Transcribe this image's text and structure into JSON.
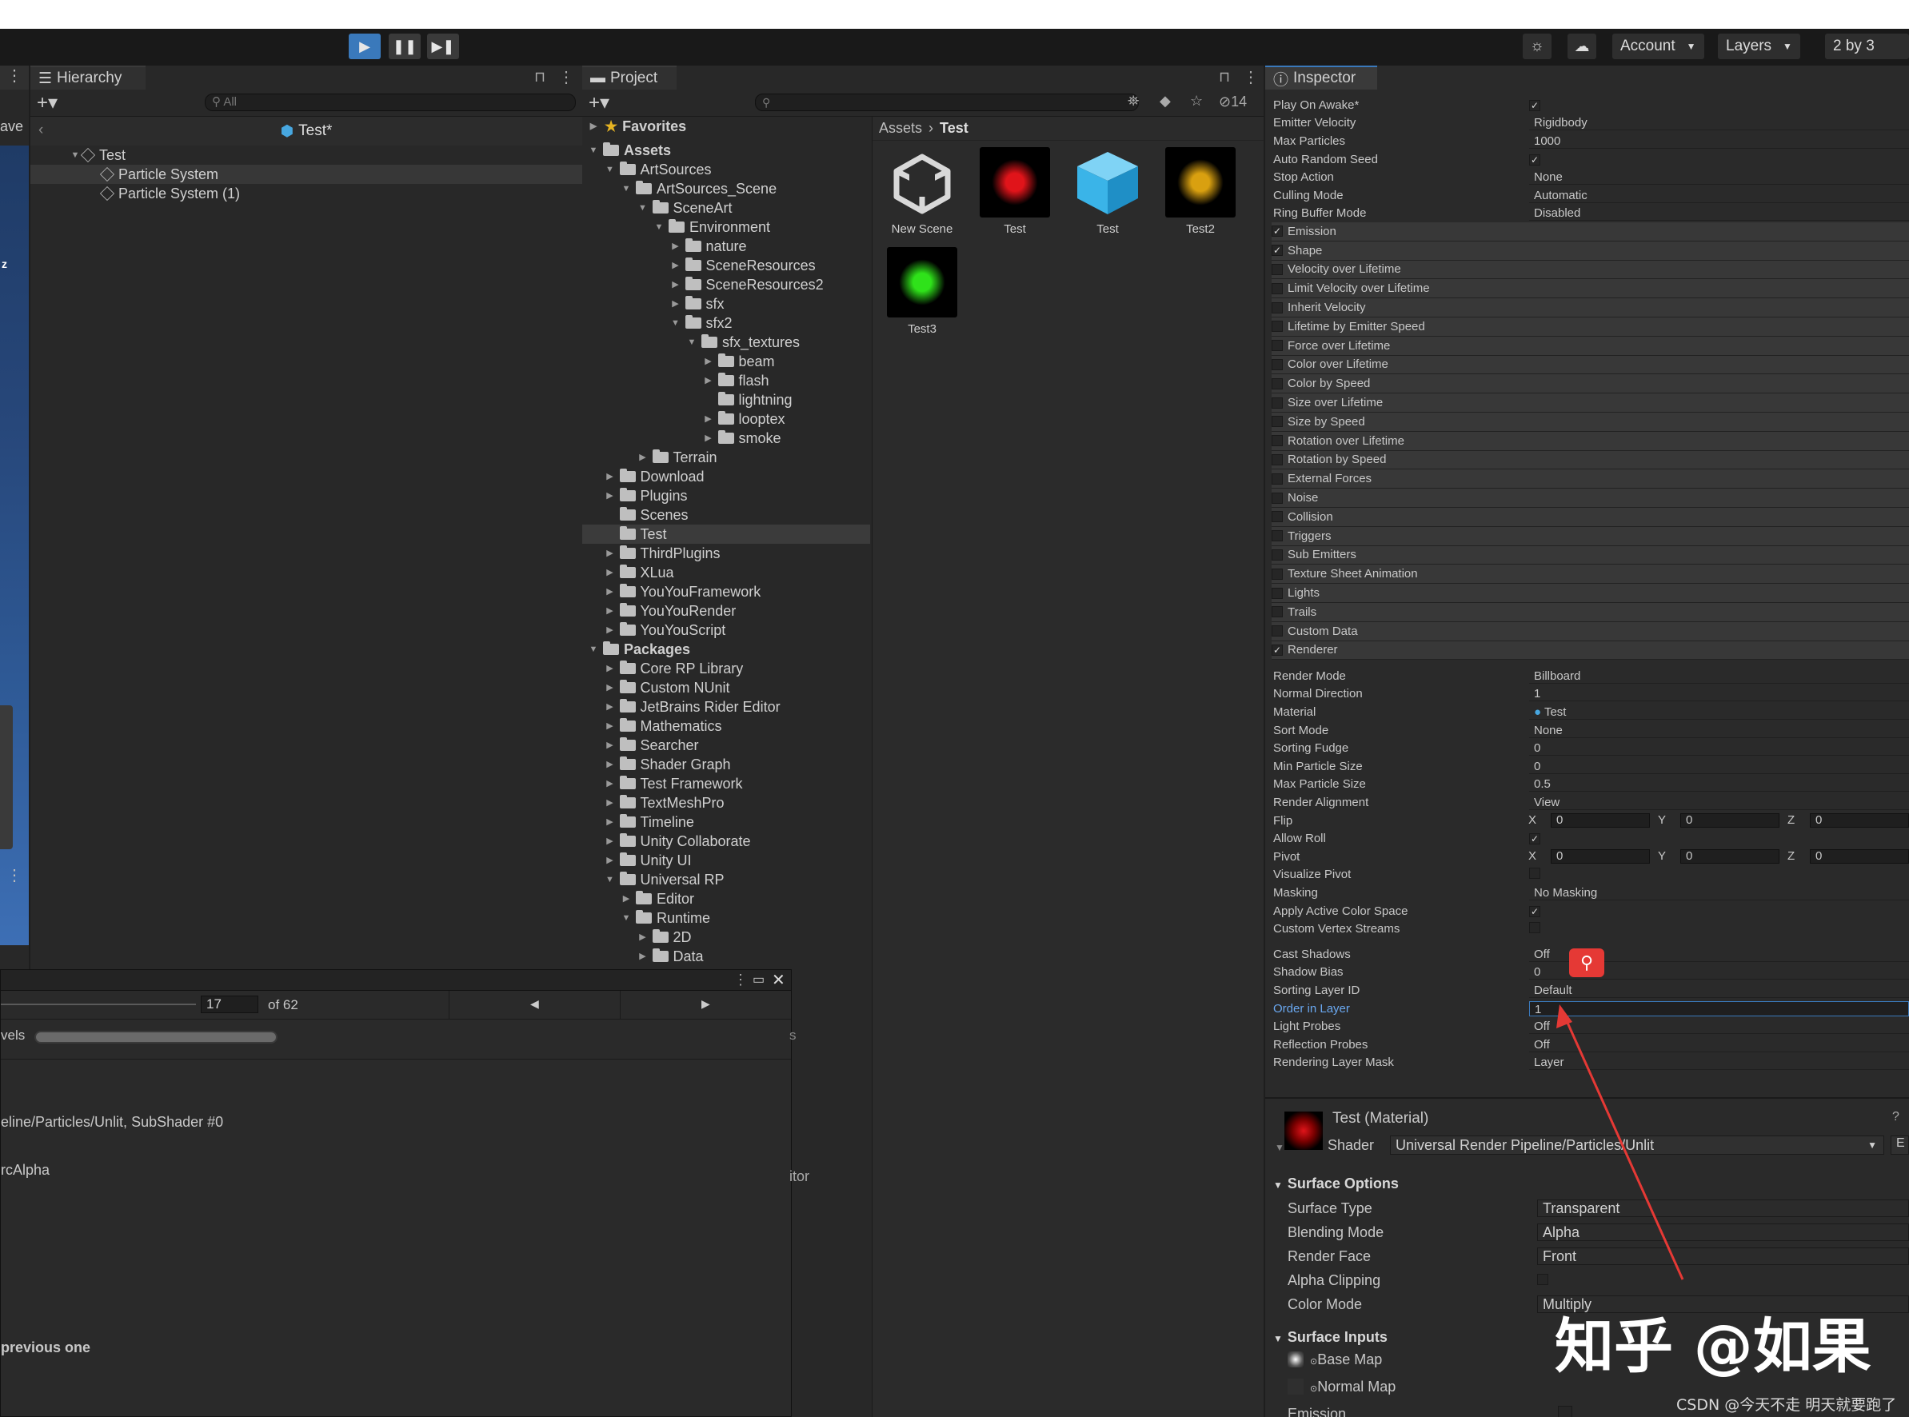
{
  "toolbar": {
    "account_label": "Account",
    "layers_label": "Layers",
    "layout_label": "2 by 3"
  },
  "left_panel": {
    "fragment_ave": "ave",
    "fragment_z": "z"
  },
  "hierarchy": {
    "tab_label": "Hierarchy",
    "search_placeholder": "All",
    "scene_title": "Test*",
    "items": [
      "Test",
      "Particle System",
      "Particle System (1)"
    ]
  },
  "project": {
    "tab_label": "Project",
    "hidden_count": "14",
    "favorites_label": "Favorites",
    "breadcrumb_root": "Assets",
    "breadcrumb_current": "Test",
    "tree": [
      {
        "label": "Assets",
        "depth": 0,
        "arrow": "down",
        "bold": true
      },
      {
        "label": "ArtSources",
        "depth": 1,
        "arrow": "down"
      },
      {
        "label": "ArtSources_Scene",
        "depth": 2,
        "arrow": "down"
      },
      {
        "label": "SceneArt",
        "depth": 3,
        "arrow": "down"
      },
      {
        "label": "Environment",
        "depth": 4,
        "arrow": "down"
      },
      {
        "label": "nature",
        "depth": 5,
        "arrow": "right"
      },
      {
        "label": "SceneResources",
        "depth": 5,
        "arrow": "right"
      },
      {
        "label": "SceneResources2",
        "depth": 5,
        "arrow": "right"
      },
      {
        "label": "sfx",
        "depth": 5,
        "arrow": "right"
      },
      {
        "label": "sfx2",
        "depth": 5,
        "arrow": "down"
      },
      {
        "label": "sfx_textures",
        "depth": 6,
        "arrow": "down"
      },
      {
        "label": "beam",
        "depth": 7,
        "arrow": "right"
      },
      {
        "label": "flash",
        "depth": 7,
        "arrow": "right"
      },
      {
        "label": "lightning",
        "depth": 7,
        "arrow": ""
      },
      {
        "label": "looptex",
        "depth": 7,
        "arrow": "right"
      },
      {
        "label": "smoke",
        "depth": 7,
        "arrow": "right"
      },
      {
        "label": "Terrain",
        "depth": 3,
        "arrow": "right"
      },
      {
        "label": "Download",
        "depth": 1,
        "arrow": "right"
      },
      {
        "label": "Plugins",
        "depth": 1,
        "arrow": "right"
      },
      {
        "label": "Scenes",
        "depth": 1,
        "arrow": ""
      },
      {
        "label": "Test",
        "depth": 1,
        "arrow": "",
        "selected": true
      },
      {
        "label": "ThirdPlugins",
        "depth": 1,
        "arrow": "right"
      },
      {
        "label": "XLua",
        "depth": 1,
        "arrow": "right"
      },
      {
        "label": "YouYouFramework",
        "depth": 1,
        "arrow": "right"
      },
      {
        "label": "YouYouRender",
        "depth": 1,
        "arrow": "right"
      },
      {
        "label": "YouYouScript",
        "depth": 1,
        "arrow": "right"
      },
      {
        "label": "Packages",
        "depth": 0,
        "arrow": "down",
        "bold": true
      },
      {
        "label": "Core RP Library",
        "depth": 1,
        "arrow": "right"
      },
      {
        "label": "Custom NUnit",
        "depth": 1,
        "arrow": "right"
      },
      {
        "label": "JetBrains Rider Editor",
        "depth": 1,
        "arrow": "right"
      },
      {
        "label": "Mathematics",
        "depth": 1,
        "arrow": "right"
      },
      {
        "label": "Searcher",
        "depth": 1,
        "arrow": "right"
      },
      {
        "label": "Shader Graph",
        "depth": 1,
        "arrow": "right"
      },
      {
        "label": "Test Framework",
        "depth": 1,
        "arrow": "right"
      },
      {
        "label": "TextMeshPro",
        "depth": 1,
        "arrow": "right"
      },
      {
        "label": "Timeline",
        "depth": 1,
        "arrow": "right"
      },
      {
        "label": "Unity Collaborate",
        "depth": 1,
        "arrow": "right"
      },
      {
        "label": "Unity UI",
        "depth": 1,
        "arrow": "right"
      },
      {
        "label": "Universal RP",
        "depth": 1,
        "arrow": "down"
      },
      {
        "label": "Editor",
        "depth": 2,
        "arrow": "right"
      },
      {
        "label": "Runtime",
        "depth": 2,
        "arrow": "down"
      },
      {
        "label": "2D",
        "depth": 3,
        "arrow": "right"
      },
      {
        "label": "Data",
        "depth": 3,
        "arrow": "right"
      }
    ],
    "assets": [
      {
        "name": "New Scene",
        "kind": "unity-scene",
        "color": ""
      },
      {
        "name": "Test",
        "kind": "glow",
        "color": "#e0141a"
      },
      {
        "name": "Test",
        "kind": "cube",
        "color": "#3ab4e8"
      },
      {
        "name": "Test2",
        "kind": "glow",
        "color": "#d9a010"
      },
      {
        "name": "Test3",
        "kind": "glow",
        "color": "#2fe21a"
      }
    ]
  },
  "floating_window": {
    "page_value": "17",
    "page_total": "of 62",
    "levels_label": "vels",
    "shader_line": "eline/Particles/Unlit, SubShader #0",
    "blend_line": "rcAlpha",
    "previous_line": "previous one",
    "side_s": "s",
    "side_itor": "itor"
  },
  "inspector": {
    "tab_label": "Inspector",
    "main_rows": [
      {
        "label": "Play On Awake*",
        "value": "",
        "check": true
      },
      {
        "label": "Emitter Velocity",
        "value": "Rigidbody"
      },
      {
        "label": "Max Particles",
        "value": "1000"
      },
      {
        "label": "Auto Random Seed",
        "value": "",
        "check": true
      },
      {
        "label": "Stop Action",
        "value": "None"
      },
      {
        "label": "Culling Mode",
        "value": "Automatic"
      },
      {
        "label": "Ring Buffer Mode",
        "value": "Disabled"
      }
    ],
    "modules": [
      {
        "label": "Emission",
        "on": true
      },
      {
        "label": "Shape",
        "on": true
      },
      {
        "label": "Velocity over Lifetime",
        "on": false
      },
      {
        "label": "Limit Velocity over Lifetime",
        "on": false
      },
      {
        "label": "Inherit Velocity",
        "on": false
      },
      {
        "label": "Lifetime by Emitter Speed",
        "on": false
      },
      {
        "label": "Force over Lifetime",
        "on": false
      },
      {
        "label": "Color over Lifetime",
        "on": false
      },
      {
        "label": "Color by Speed",
        "on": false
      },
      {
        "label": "Size over Lifetime",
        "on": false
      },
      {
        "label": "Size by Speed",
        "on": false
      },
      {
        "label": "Rotation over Lifetime",
        "on": false
      },
      {
        "label": "Rotation by Speed",
        "on": false
      },
      {
        "label": "External Forces",
        "on": false
      },
      {
        "label": "Noise",
        "on": false
      },
      {
        "label": "Collision",
        "on": false
      },
      {
        "label": "Triggers",
        "on": false
      },
      {
        "label": "Sub Emitters",
        "on": false
      },
      {
        "label": "Texture Sheet Animation",
        "on": false
      },
      {
        "label": "Lights",
        "on": false
      },
      {
        "label": "Trails",
        "on": false
      },
      {
        "label": "Custom Data",
        "on": false
      },
      {
        "label": "Renderer",
        "on": true
      }
    ],
    "renderer_rows": [
      {
        "label": "Render Mode",
        "value": "Billboard"
      },
      {
        "label": "Normal Direction",
        "value": "1"
      },
      {
        "label": "Material",
        "value": "Test",
        "dot": true
      },
      {
        "label": "Sort Mode",
        "value": "None"
      },
      {
        "label": "Sorting Fudge",
        "value": "0"
      },
      {
        "label": "Min Particle Size",
        "value": "0"
      },
      {
        "label": "Max Particle Size",
        "value": "0.5"
      },
      {
        "label": "Render Alignment",
        "value": "View"
      },
      {
        "label": "Flip",
        "value": "",
        "xyz": [
          "0",
          "0",
          "0"
        ]
      },
      {
        "label": "Allow Roll",
        "value": "",
        "check": true
      },
      {
        "label": "Pivot",
        "value": "",
        "xyz": [
          "0",
          "0",
          "0"
        ]
      },
      {
        "label": "Visualize Pivot",
        "value": "",
        "check": false
      },
      {
        "label": "Masking",
        "value": "No Masking"
      },
      {
        "label": "Apply Active Color Space",
        "value": "",
        "check": true
      },
      {
        "label": "Custom Vertex Streams",
        "value": "",
        "check": false
      }
    ],
    "lower_rows": [
      {
        "label": "Cast Shadows",
        "value": "Off"
      },
      {
        "label": "Shadow Bias",
        "value": "0"
      },
      {
        "label": "Sorting Layer ID",
        "value": "Default"
      },
      {
        "label": "Order in Layer",
        "value": "1",
        "highlight": true
      },
      {
        "label": "Light Probes",
        "value": "Off"
      },
      {
        "label": "Reflection Probes",
        "value": "Off"
      },
      {
        "label": "Rendering Layer Mask",
        "value": "Layer"
      }
    ],
    "material": {
      "title": "Test (Material)",
      "shader_label": "Shader",
      "shader_value": "Universal Render Pipeline/Particles/Unlit",
      "edit_label": "E",
      "surface_options_label": "Surface Options",
      "surface_rows": [
        {
          "label": "Surface Type",
          "value": "Transparent"
        },
        {
          "label": "Blending Mode",
          "value": "Alpha"
        },
        {
          "label": "Render Face",
          "value": "Front"
        },
        {
          "label": "Alpha Clipping",
          "value": "",
          "check": false
        },
        {
          "label": "Color Mode",
          "value": "Multiply"
        }
      ],
      "surface_inputs_label": "Surface Inputs",
      "base_map_label": "Base Map",
      "normal_map_label": "Normal Map",
      "emission_label": "Emission"
    }
  },
  "watermark": {
    "zhihu": "知乎 @如果",
    "csdn": "CSDN @今天不走 明天就要跑了"
  },
  "colors": {
    "accent_blue": "#3a79bb",
    "annotation_red": "#e53935",
    "panel_bg": "#282828"
  }
}
